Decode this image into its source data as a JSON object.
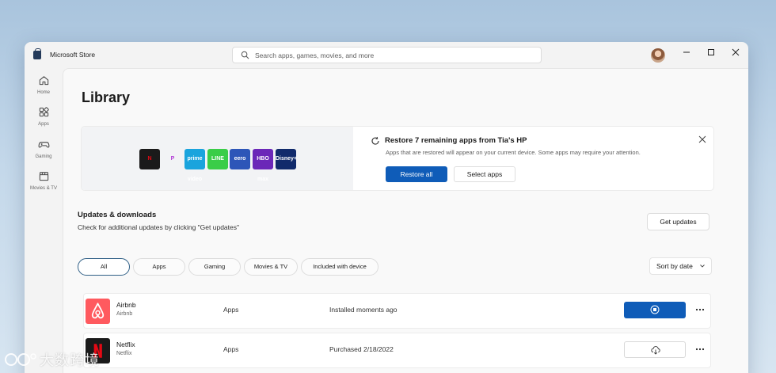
{
  "window": {
    "title": "Microsoft Store"
  },
  "search": {
    "placeholder": "Search apps, games, movies, and more"
  },
  "sidebar": {
    "items": [
      {
        "label": "Home",
        "icon": "home-icon"
      },
      {
        "label": "Apps",
        "icon": "apps-icon"
      },
      {
        "label": "Gaming",
        "icon": "controller-icon"
      },
      {
        "label": "Movies & TV",
        "icon": "clapperboard-icon"
      }
    ]
  },
  "page": {
    "title": "Library"
  },
  "restore": {
    "title": "Restore 7 remaining apps from Tia's HP",
    "description": "Apps that are restored will appear on your current device. Some apps may require your attention.",
    "primary_label": "Restore all",
    "secondary_label": "Select apps",
    "tiles": [
      {
        "name": "Netflix",
        "text": "N",
        "color": "#1a1a1a",
        "fg": "#e50914"
      },
      {
        "name": "Pandora",
        "text": "P",
        "color": "#f2f3f5",
        "fg": "#b23ad6"
      },
      {
        "name": "Prime Video",
        "text": "prime video",
        "color": "#1aa4dd",
        "fg": "#ffffff"
      },
      {
        "name": "LINE",
        "text": "LINE",
        "color": "#3acd48",
        "fg": "#ffffff"
      },
      {
        "name": "eero",
        "text": "eero",
        "color": "#2d56b8",
        "fg": "#ffffff"
      },
      {
        "name": "HBO Max",
        "text": "HBO max",
        "color": "#6b27b8",
        "fg": "#ffffff"
      },
      {
        "name": "Disney+",
        "text": "Disney+",
        "color": "#112a6b",
        "fg": "#ffffff"
      }
    ]
  },
  "updates": {
    "title": "Updates & downloads",
    "description": "Check for additional updates by clicking \"Get updates\"",
    "button_label": "Get updates"
  },
  "filters": [
    {
      "label": "All",
      "active": true
    },
    {
      "label": "Apps",
      "active": false
    },
    {
      "label": "Gaming",
      "active": false
    },
    {
      "label": "Movies & TV",
      "active": false
    },
    {
      "label": "Included with device",
      "active": false
    }
  ],
  "sort": {
    "label": "Sort by date"
  },
  "library_items": [
    {
      "name": "Airbnb",
      "publisher": "Airbnb",
      "category": "Apps",
      "status": "Installed moments ago",
      "action": "stop-icon"
    },
    {
      "name": "Netflix",
      "publisher": "Netflix",
      "category": "Apps",
      "status": "Purchased 2/18/2022",
      "action": "cloud-download-icon"
    }
  ],
  "watermark": {
    "text": "大数跨境"
  },
  "colors": {
    "accent": "#0f5cb8",
    "airbnb": "#ff5a5f",
    "netflix_bg": "#1a1a1a",
    "netflix_red": "#e50914"
  }
}
